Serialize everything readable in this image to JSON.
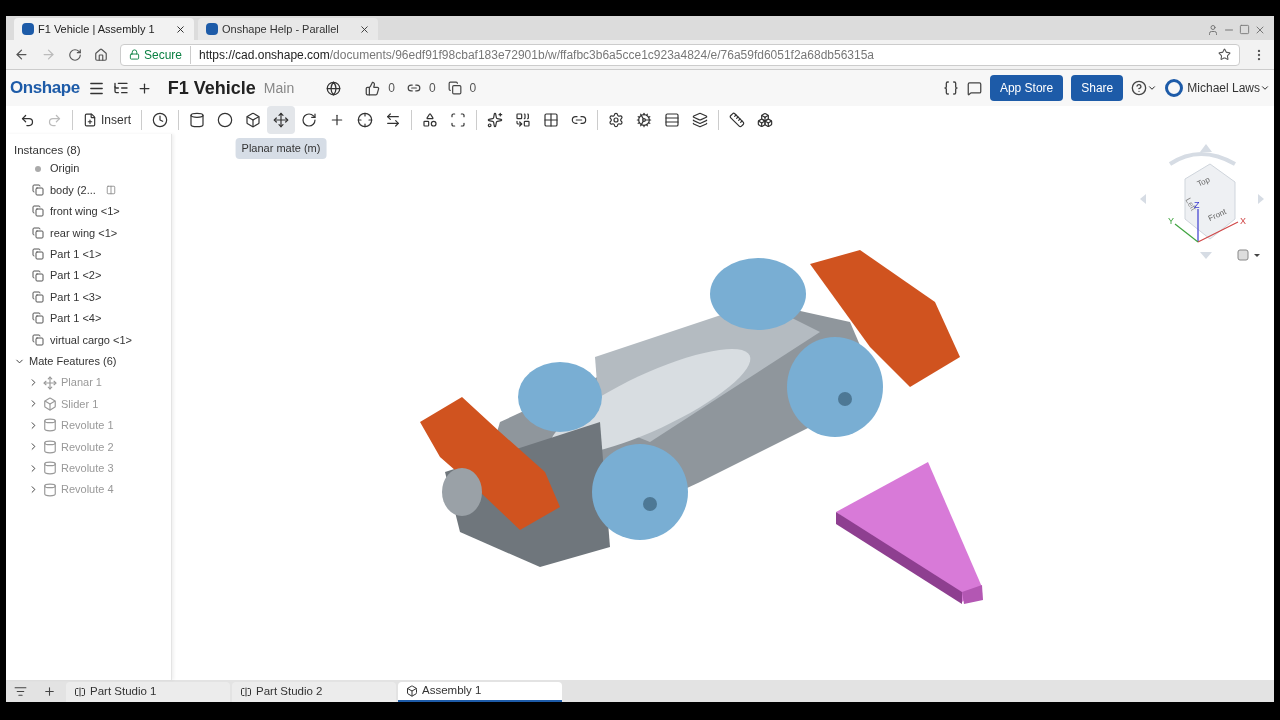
{
  "browser": {
    "tabs": [
      {
        "title": "F1 Vehicle | Assembly 1",
        "selected": true
      },
      {
        "title": "Onshape Help - Parallel",
        "selected": false
      }
    ],
    "secure_label": "Secure",
    "url_host": "https://cad.onshape.com",
    "url_path": "/documents/96edf91f98cbaf183e72901b/w/ffafbc3b6a5cce1c923a4824/e/76a59fd6051f2a68db56315a"
  },
  "header": {
    "logo": "Onshape",
    "document_title": "F1 Vehicle",
    "branch": "Main",
    "likes": "0",
    "links": "0",
    "copies": "0",
    "app_store": "App Store",
    "share": "Share",
    "user": "Michael Laws"
  },
  "toolbar": {
    "insert": "Insert",
    "tooltip": "Planar mate (m)",
    "tools": [
      {
        "hovered": false
      },
      {
        "hovered": false
      },
      {
        "hovered": false
      },
      {
        "hovered": false
      },
      {
        "hovered": true
      },
      {
        "hovered": false
      },
      {
        "hovered": false
      },
      {
        "hovered": false
      },
      {
        "hovered": false
      },
      {
        "hovered": false
      },
      {
        "hovered": false
      },
      {
        "hovered": false
      },
      {
        "hovered": false
      },
      {
        "hovered": false
      },
      {
        "hovered": false
      },
      {
        "hovered": false
      },
      {
        "hovered": false
      },
      {
        "hovered": false
      },
      {
        "hovered": false
      },
      {
        "hovered": false
      },
      {
        "hovered": false
      }
    ]
  },
  "sidebar": {
    "instances_title": "Instances (8)",
    "instances": [
      {
        "kind": "origin",
        "label": "Origin"
      },
      {
        "kind": "part",
        "label": "body (2...",
        "flag": true
      },
      {
        "kind": "part",
        "label": "front wing <1>"
      },
      {
        "kind": "part",
        "label": "rear wing <1>"
      },
      {
        "kind": "part",
        "label": "Part 1 <1>"
      },
      {
        "kind": "part",
        "label": "Part 1 <2>"
      },
      {
        "kind": "part",
        "label": "Part 1 <3>"
      },
      {
        "kind": "part",
        "label": "Part 1 <4>"
      },
      {
        "kind": "part",
        "label": "virtual cargo <1>"
      }
    ],
    "mates_title": "Mate Features (6)",
    "mates_expanded": true,
    "mates": [
      {
        "kind": "planar",
        "label": "Planar 1",
        "expanded": false
      },
      {
        "kind": "slider",
        "label": "Slider 1",
        "expanded": false
      },
      {
        "kind": "revolute",
        "label": "Revolute 1",
        "expanded": false
      },
      {
        "kind": "revolute",
        "label": "Revolute 2",
        "expanded": false
      },
      {
        "kind": "revolute",
        "label": "Revolute 3",
        "expanded": false
      },
      {
        "kind": "revolute",
        "label": "Revolute 4",
        "expanded": false
      }
    ]
  },
  "view_cube": {
    "top": "Top",
    "front": "Front",
    "left": "Left",
    "x": "X",
    "y": "Y",
    "z": "Z"
  },
  "bottom_tabs": [
    {
      "kind": "part_studio",
      "label": "Part Studio 1",
      "selected": false
    },
    {
      "kind": "part_studio",
      "label": "Part Studio 2",
      "selected": false
    },
    {
      "kind": "assembly",
      "label": "Assembly 1",
      "selected": true
    }
  ]
}
